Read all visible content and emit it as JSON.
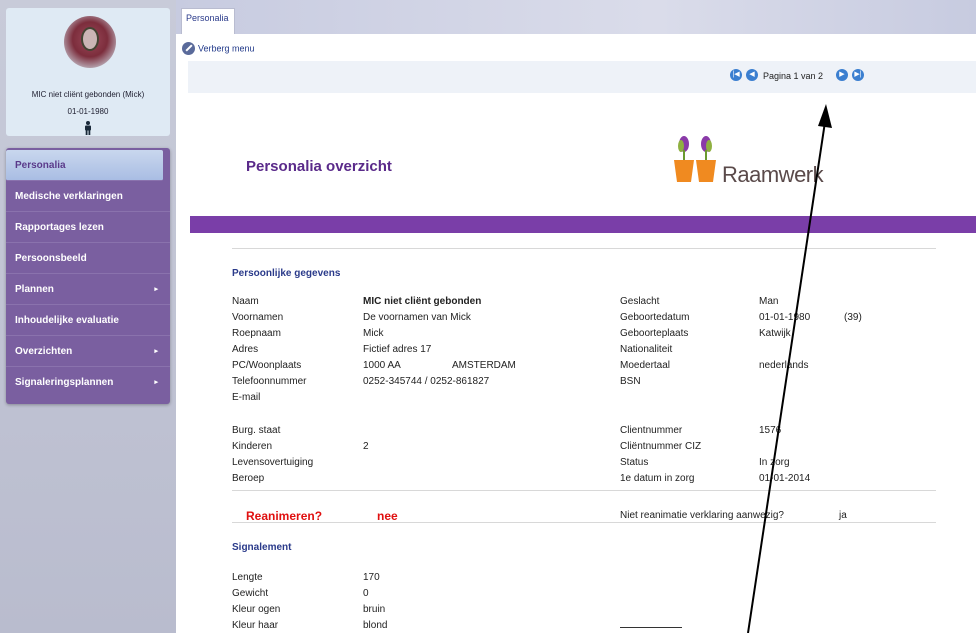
{
  "profile": {
    "name": "MIC niet cliënt gebonden  (Mick)",
    "dob": "01-01-1980",
    "avatar_icon": "user-avatar",
    "gender_icon": "person-icon"
  },
  "menu": {
    "items": [
      {
        "label": "Personalia",
        "active": true,
        "has_submenu": false
      },
      {
        "label": "Medische verklaringen",
        "active": false,
        "has_submenu": false
      },
      {
        "label": "Rapportages lezen",
        "active": false,
        "has_submenu": false
      },
      {
        "label": "Persoonsbeeld",
        "active": false,
        "has_submenu": false
      },
      {
        "label": "Plannen",
        "active": false,
        "has_submenu": true
      },
      {
        "label": "Inhoudelijke evaluatie",
        "active": false,
        "has_submenu": false
      },
      {
        "label": "Overzichten",
        "active": false,
        "has_submenu": true
      },
      {
        "label": "Signaleringsplannen",
        "active": false,
        "has_submenu": true
      }
    ],
    "submenu_arrow": "▸"
  },
  "tabs": {
    "active_tab": "Personalia"
  },
  "toolbar": {
    "hide_menu": "Verberg menu"
  },
  "pager": {
    "text": "Pagina 1 van 2",
    "first_icon": "first-page-icon",
    "prev_icon": "prev-page-icon",
    "next_icon": "next-page-icon",
    "last_icon": "last-page-icon"
  },
  "report": {
    "title": "Personalia overzicht",
    "logo_text": "Raamwerk",
    "brand_color": "#7a3ea8"
  },
  "personal": {
    "heading": "Persoonlijke gegevens",
    "left": [
      {
        "label": "Naam",
        "value": "MIC niet cliënt gebonden",
        "value2": "",
        "bold": true
      },
      {
        "label": "Voornamen",
        "value": "De voornamen van Mick",
        "value2": "",
        "bold": false
      },
      {
        "label": "Roepnaam",
        "value": "Mick",
        "value2": "",
        "bold": false
      },
      {
        "label": "Adres",
        "value": "Fictief adres 17",
        "value2": "",
        "bold": false
      },
      {
        "label": "PC/Woonplaats",
        "value": "1000 AA",
        "value2": "AMSTERDAM",
        "bold": false
      },
      {
        "label": "Telefoonnummer",
        "value": "0252-345744 / 0252-861827",
        "value2": "",
        "bold": false
      },
      {
        "label": "E-mail",
        "value": "",
        "value2": "",
        "bold": false
      }
    ],
    "right": [
      {
        "label": "Geslacht",
        "value": "Man",
        "value2": ""
      },
      {
        "label": "Geboortedatum",
        "value": "01-01-1980",
        "value2": "(39)"
      },
      {
        "label": "Geboorteplaats",
        "value": "Katwijk",
        "value2": ""
      },
      {
        "label": "Nationaliteit",
        "value": "",
        "value2": ""
      },
      {
        "label": "Moedertaal",
        "value": "nederlands",
        "value2": ""
      },
      {
        "label": "BSN",
        "value": "",
        "value2": ""
      }
    ]
  },
  "status_block": {
    "left": [
      {
        "label": "Burg. staat",
        "value": ""
      },
      {
        "label": "Kinderen",
        "value": "2"
      },
      {
        "label": "Levensovertuiging",
        "value": ""
      },
      {
        "label": "Beroep",
        "value": ""
      }
    ],
    "right": [
      {
        "label": "Clientnummer",
        "value": "1576"
      },
      {
        "label": "Cliëntnummer CIZ",
        "value": ""
      },
      {
        "label": "Status",
        "value": "In zorg"
      },
      {
        "label": "1e datum in zorg",
        "value": "01-01-2014"
      }
    ]
  },
  "resuscitation": {
    "label": "Reanimeren?",
    "value": "nee",
    "declaration_label": "Niet reanimatie verklaring aanwezig?",
    "declaration_value": "ja",
    "color": "#e01010"
  },
  "signalement": {
    "heading": "Signalement",
    "rows": [
      {
        "label": "Lengte",
        "value": "170"
      },
      {
        "label": "Gewicht",
        "value": "0"
      },
      {
        "label": "Kleur ogen",
        "value": "bruin"
      },
      {
        "label": "Kleur haar",
        "value": "blond"
      }
    ]
  }
}
